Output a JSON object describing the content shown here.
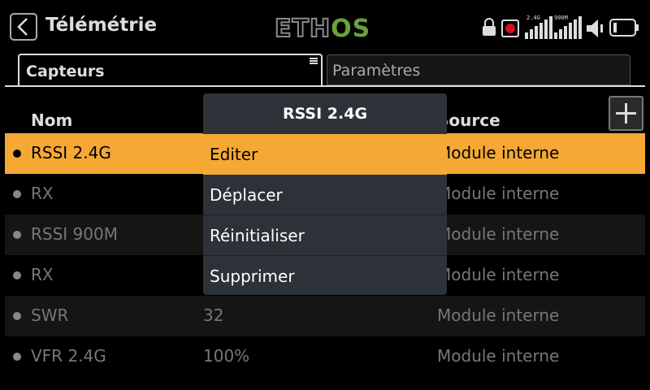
{
  "header": {
    "title": "Télémétrie",
    "logo_left": "ETH",
    "logo_right": "OS",
    "status": {
      "rssi_24_label": "2.4G",
      "rssi_900_label": "900M"
    }
  },
  "tabs": [
    {
      "label": "Capteurs",
      "active": true
    },
    {
      "label": "Paramètres",
      "active": false
    }
  ],
  "table": {
    "headers": {
      "name": "Nom",
      "source": "Source"
    },
    "rows": [
      {
        "name": "RSSI 2.4G",
        "value": "",
        "source": "Module interne",
        "selected": true
      },
      {
        "name": "RX",
        "value": "",
        "source": "Module interne"
      },
      {
        "name": "RSSI 900M",
        "value": "",
        "source": "Module interne"
      },
      {
        "name": "RX",
        "value": "",
        "source": "Module interne"
      },
      {
        "name": "SWR",
        "value": "32",
        "source": "Module interne"
      },
      {
        "name": "VFR 2.4G",
        "value": "100%",
        "source": "Module interne"
      }
    ]
  },
  "popup": {
    "title": "RSSI 2.4G",
    "items": [
      "Editer",
      "Déplacer",
      "Réinitialiser",
      "Supprimer"
    ],
    "selected_index": 0
  },
  "colors": {
    "accent": "#f5a833",
    "popup_bg": "#2c3238",
    "logo_green": "#6aa13a"
  }
}
